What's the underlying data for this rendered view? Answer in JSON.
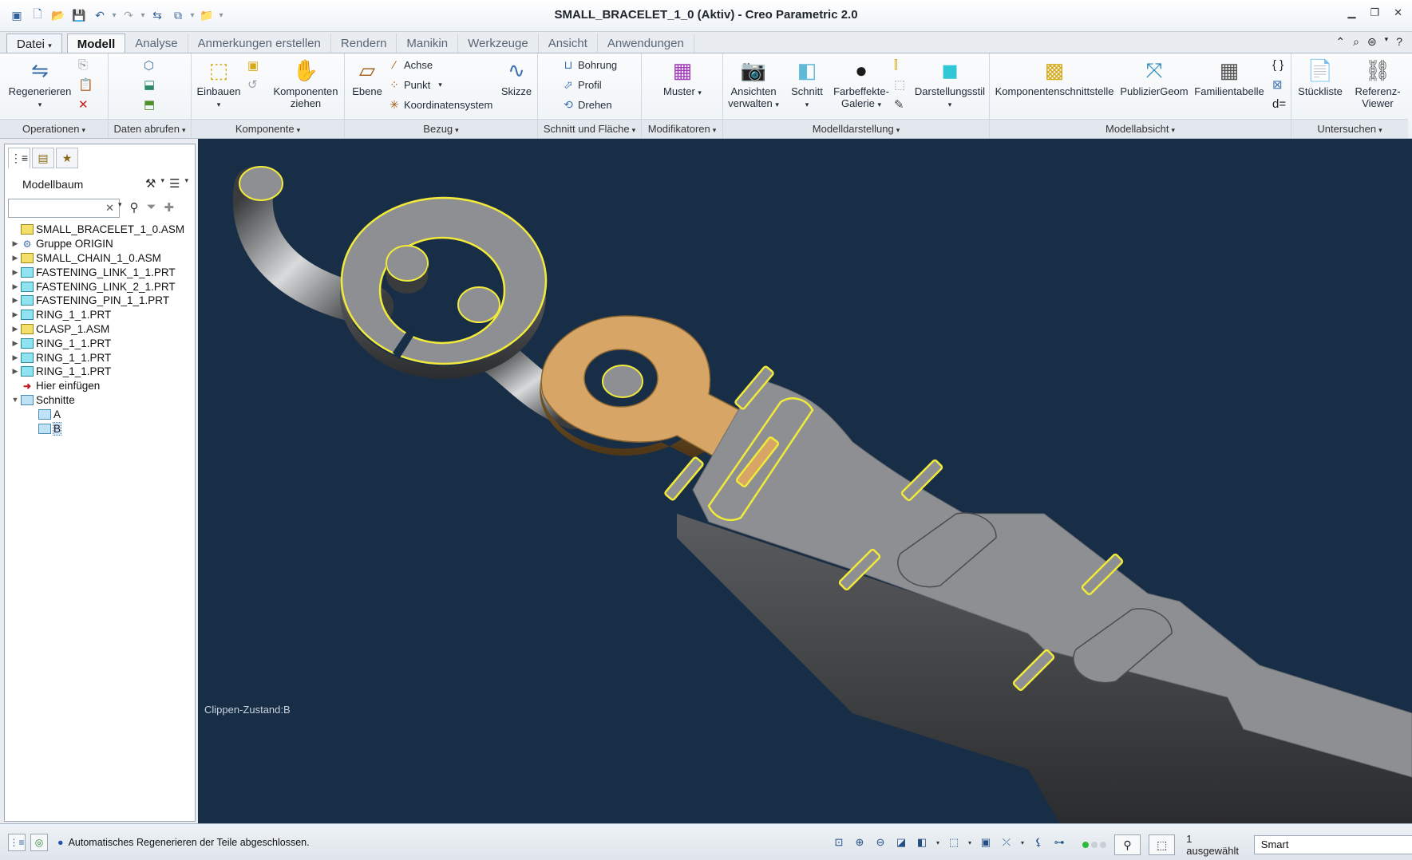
{
  "window": {
    "title": "SMALL_BRACELET_1_0 (Aktiv) - Creo Parametric 2.0"
  },
  "tabs": [
    {
      "label": "Datei"
    },
    {
      "label": "Modell"
    },
    {
      "label": "Analyse"
    },
    {
      "label": "Anmerkungen erstellen"
    },
    {
      "label": "Rendern"
    },
    {
      "label": "Manikin"
    },
    {
      "label": "Werkzeuge"
    },
    {
      "label": "Ansicht"
    },
    {
      "label": "Anwendungen"
    }
  ],
  "ribbon": {
    "operationen": {
      "group": "Operationen",
      "regenerieren": "Regenerieren"
    },
    "daten_abrufen": {
      "group": "Daten abrufen"
    },
    "komponente": {
      "group": "Komponente",
      "einbauen": "Einbauen",
      "komponenten_ziehen_1": "Komponenten",
      "komponenten_ziehen_2": "ziehen"
    },
    "bezug": {
      "group": "Bezug",
      "ebene": "Ebene",
      "achse": "Achse",
      "punkt": "Punkt",
      "koordinatensystem": "Koordinatensystem",
      "skizze": "Skizze"
    },
    "schnitt_flaeche": {
      "group": "Schnitt und Fläche",
      "bohrung": "Bohrung",
      "profil": "Profil",
      "drehen": "Drehen"
    },
    "modifikatoren": {
      "group": "Modifikatoren",
      "muster": "Muster"
    },
    "modelldarstellung": {
      "group": "Modelldarstellung",
      "ansichten_1": "Ansichten",
      "ansichten_2": "verwalten",
      "schnitt": "Schnitt",
      "farbeffekte_1": "Farbeffekte-",
      "farbeffekte_2": "Galerie",
      "darstellungsstil": "Darstellungsstil"
    },
    "modellabsicht": {
      "group": "Modellabsicht",
      "komponentenschnittstelle": "Komponentenschnittstelle",
      "publiziergeom": "PublizierGeom",
      "familientabelle": "Familientabelle"
    },
    "untersuchen": {
      "group": "Untersuchen",
      "stueckliste": "Stückliste",
      "referenz_1": "Referenz-",
      "referenz_2": "Viewer"
    }
  },
  "panel": {
    "title": "Modellbaum",
    "search_value": "",
    "tree": [
      {
        "label": "SMALL_BRACELET_1_0.ASM",
        "icon": "assembly-icon",
        "level": 0,
        "toggle": ""
      },
      {
        "label": "Gruppe ORIGIN",
        "icon": "group-icon",
        "level": 1,
        "toggle": "▶"
      },
      {
        "label": "SMALL_CHAIN_1_0.ASM",
        "icon": "assembly-icon",
        "level": 1,
        "toggle": "▶"
      },
      {
        "label": "FASTENING_LINK_1_1.PRT",
        "icon": "part-icon",
        "level": 1,
        "toggle": "▶"
      },
      {
        "label": "FASTENING_LINK_2_1.PRT",
        "icon": "part-icon",
        "level": 1,
        "toggle": "▶"
      },
      {
        "label": "FASTENING_PIN_1_1.PRT",
        "icon": "part-icon",
        "level": 1,
        "toggle": "▶"
      },
      {
        "label": "RING_1_1.PRT",
        "icon": "part-icon",
        "level": 1,
        "toggle": "▶"
      },
      {
        "label": "CLASP_1.ASM",
        "icon": "assembly-icon",
        "level": 1,
        "toggle": "▶"
      },
      {
        "label": "RING_1_1.PRT",
        "icon": "part-icon",
        "level": 1,
        "toggle": "▶"
      },
      {
        "label": "RING_1_1.PRT",
        "icon": "part-icon",
        "level": 1,
        "toggle": "▶"
      },
      {
        "label": "RING_1_1.PRT",
        "icon": "part-icon",
        "level": 1,
        "toggle": "▶"
      },
      {
        "label": "Hier einfügen",
        "icon": "insert-here-icon",
        "level": 1,
        "toggle": ""
      },
      {
        "label": "Schnitte",
        "icon": "sections-icon",
        "level": 1,
        "toggle": "▼"
      },
      {
        "label": "A",
        "icon": "section-icon",
        "level": 2,
        "toggle": ""
      },
      {
        "label": "B",
        "icon": "section-active-icon",
        "level": 2,
        "toggle": "",
        "selected": true
      }
    ]
  },
  "viewport": {
    "clip_state": "Clippen-Zustand:B",
    "background": "#182d46",
    "highlight": "#f2ea3a",
    "selected_part_color": "#d7a566",
    "part_color": "#8d8f92"
  },
  "status": {
    "message": "Automatisches Regenerieren der Teile abgeschlossen.",
    "selected": "1 ausgewählt",
    "filter": "Smart"
  }
}
